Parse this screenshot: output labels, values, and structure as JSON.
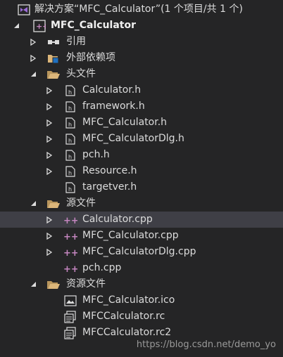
{
  "solution": {
    "label": "解决方案“MFC_Calculator”(1 个项目/共 1 个)"
  },
  "project": {
    "label": "MFC_Calculator"
  },
  "references": {
    "label": "引用"
  },
  "external_deps": {
    "label": "外部依赖项"
  },
  "headers": {
    "label": "头文件",
    "files": [
      {
        "label": "Calculator.h"
      },
      {
        "label": "framework.h"
      },
      {
        "label": "MFC_Calculator.h"
      },
      {
        "label": "MFC_CalculatorDlg.h"
      },
      {
        "label": "pch.h"
      },
      {
        "label": "Resource.h"
      },
      {
        "label": "targetver.h"
      }
    ]
  },
  "sources": {
    "label": "源文件",
    "files": [
      {
        "label": "Calculator.cpp"
      },
      {
        "label": "MFC_Calculator.cpp"
      },
      {
        "label": "MFC_CalculatorDlg.cpp"
      },
      {
        "label": "pch.cpp"
      }
    ]
  },
  "resources": {
    "label": "资源文件",
    "files": [
      {
        "label": "MFC_Calculator.ico"
      },
      {
        "label": "MFCCalculator.rc"
      },
      {
        "label": "MFCCalculator.rc2"
      }
    ]
  },
  "watermark": {
    "text": "https://blog.csdn.net/demo_yo"
  },
  "colors": {
    "background": "#252526",
    "selected": "#3f3f46",
    "text": "#dcdcdc",
    "folder": "#dcb67a",
    "cpp": "#c586c0"
  }
}
